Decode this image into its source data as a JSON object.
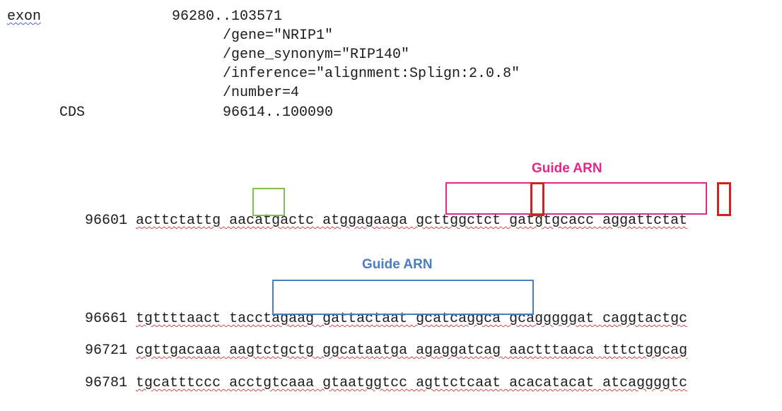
{
  "feature_table": {
    "exon_key": "exon",
    "exon_location": "96280..103571",
    "qualifiers": [
      "/gene=\"NRIP1\"",
      "/gene_synonym=\"RIP140\"",
      "/inference=\"alignment:Splign:2.0.8\"",
      "/number=4"
    ],
    "cds_key": "CDS",
    "cds_location": "96614..100090"
  },
  "annotations": {
    "guide1_label": "Guide ARN",
    "guide1_color": "#e0288a",
    "guide2_label": "Guide ARN",
    "guide2_color": "#4a7cc2",
    "start_codon_color": "#7dc24a",
    "mutation_color": "#d42020"
  },
  "sequence": [
    {
      "pos": "96601",
      "text": "acttctattg aacatgactc atggagaaga gcttggctct gatgtgcacc aggattctat"
    },
    {
      "pos": "96661",
      "text": "tgttttaact tacctagaag gattactaat gcatcaggca gcagggggat caggtactgc"
    },
    {
      "pos": "96721",
      "text": "cgttgacaaa aagtctgctg ggcataatga agaggatcag aactttaaca tttctggcag"
    },
    {
      "pos": "96781",
      "text": "tgcatttccc acctgtcaaa gtaatggtcc agttctcaat acacatacat atcaggggtc"
    }
  ]
}
